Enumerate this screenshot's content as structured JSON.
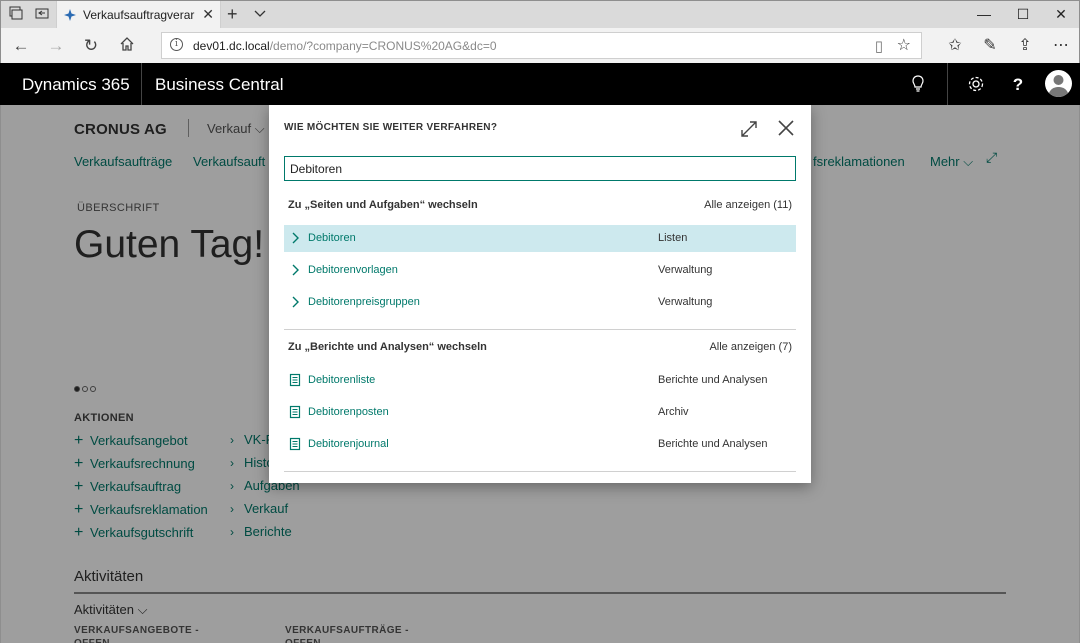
{
  "browser": {
    "tab_title": "Verkaufsauftragverarbei",
    "url_host": "dev01.dc.local",
    "url_rest": "/demo/?company=CRONUS%20AG&dc=0"
  },
  "app": {
    "name": "Dynamics 365",
    "product": "Business Central"
  },
  "page": {
    "company": "CRONUS AG",
    "company_menu": "Verkauf",
    "nav": [
      "Verkaufsaufträge",
      "Verkaufsauft",
      "fsreklamationen",
      "Mehr"
    ],
    "headline_caption": "ÜBERSCHRIFT",
    "greeting": "Guten Tag!",
    "actions_caption": "AKTIONEN",
    "actions_col1": [
      "Verkaufsangebot",
      "Verkaufsrechnung",
      "Verkaufsauftrag",
      "Verkaufsreklamation",
      "Verkaufsgutschrift"
    ],
    "actions_col2": [
      "VK-P",
      "Histo",
      "Aufgaben",
      "Verkauf",
      "Berichte"
    ],
    "activities_title": "Aktivitäten",
    "activities_sub": "Aktivitäten",
    "tiles": [
      "VERKAUFSANGEBOTE - OFFEN",
      "VERKAUFSAUFTRÄGE - OFFEN"
    ]
  },
  "dialog": {
    "title": "WIE MÖCHTEN SIE WEITER VERFAHREN?",
    "search_value": "Debitoren",
    "group1": {
      "title": "Zu „Seiten und Aufgaben“ wechseln",
      "show_all": "Alle anzeigen (11)",
      "items": [
        {
          "label": "Debitoren",
          "category": "Listen"
        },
        {
          "label": "Debitorenvorlagen",
          "category": "Verwaltung"
        },
        {
          "label": "Debitorenpreisgruppen",
          "category": "Verwaltung"
        }
      ]
    },
    "group2": {
      "title": "Zu „Berichte und Analysen“ wechseln",
      "show_all": "Alle anzeigen (7)",
      "items": [
        {
          "label": "Debitorenliste",
          "category": "Berichte und Analysen"
        },
        {
          "label": "Debitorenposten",
          "category": "Archiv"
        },
        {
          "label": "Debitorenjournal",
          "category": "Berichte und Analysen"
        }
      ]
    }
  },
  "colors": {
    "accent": "#00796b",
    "selected_row": "#cde9ee",
    "app_bar": "#000000"
  }
}
